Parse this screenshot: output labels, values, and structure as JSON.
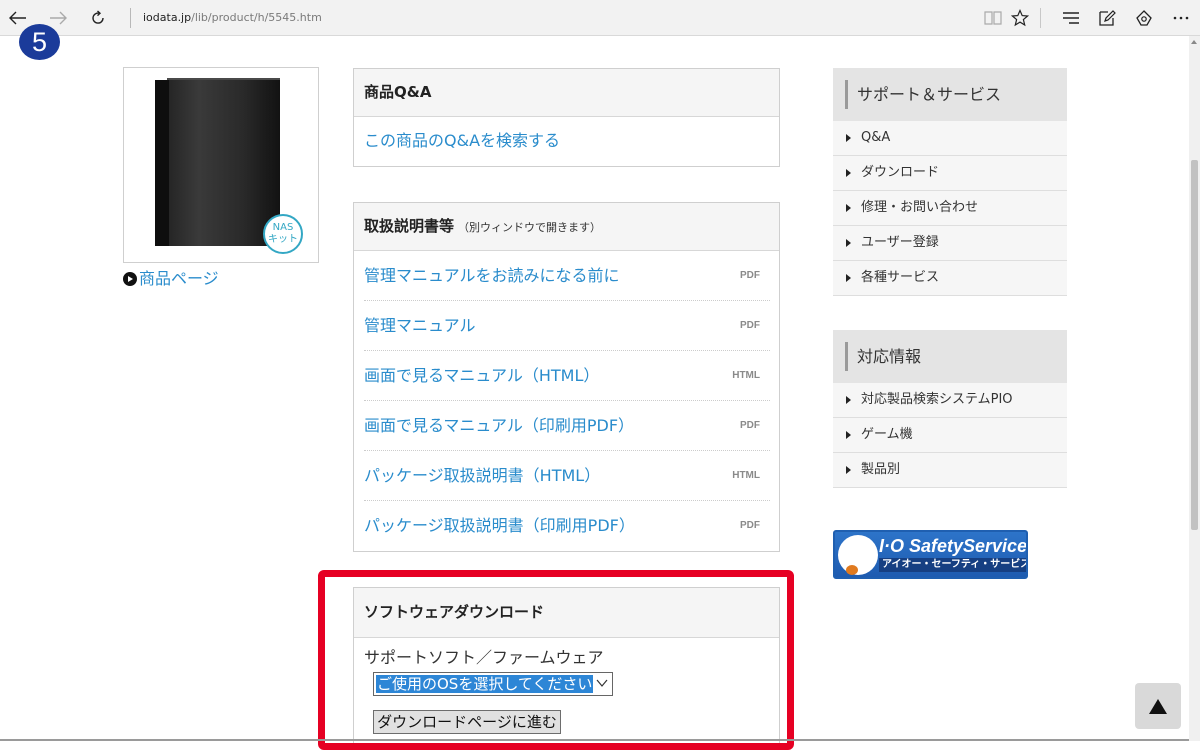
{
  "browser": {
    "address_host": "iodata.jp",
    "address_path": "/lib/product/h/5545.htm"
  },
  "step_badge": "5",
  "product": {
    "nas_badge_line1": "NAS",
    "nas_badge_line2": "キット",
    "link_label": "商品ページ"
  },
  "qa_panel": {
    "title": "商品Q&A",
    "link_label": "この商品のQ&Aを検索する"
  },
  "manual_panel": {
    "title": "取扱説明書等",
    "subtitle": "（別ウィンドウで開きます）",
    "items": [
      {
        "label": "管理マニュアルをお読みになる前に",
        "type": "PDF"
      },
      {
        "label": "管理マニュアル",
        "type": "PDF"
      },
      {
        "label": "画面で見るマニュアル（HTML）",
        "type": "HTML"
      },
      {
        "label": "画面で見るマニュアル（印刷用PDF）",
        "type": "PDF"
      },
      {
        "label": "パッケージ取扱説明書（HTML）",
        "type": "HTML"
      },
      {
        "label": "パッケージ取扱説明書（印刷用PDF）",
        "type": "PDF"
      }
    ]
  },
  "software_panel": {
    "title": "ソフトウェアダウンロード",
    "label": "サポートソフト／ファームウェア",
    "os_select_value": "ご使用のOSを選択してください",
    "download_button": "ダウンロードページに進む"
  },
  "support_menu": {
    "title": "サポート＆サービス",
    "items": [
      "Q&A",
      "ダウンロード",
      "修理・お問い合わせ",
      "ユーザー登録",
      "各種サービス"
    ]
  },
  "compat_menu": {
    "title": "対応情報",
    "items": [
      "対応製品検索システムPIO",
      "ゲーム機",
      "製品別"
    ]
  },
  "safety_banner": {
    "title": "I·O SafetyService",
    "subtitle": "アイオー・セーフティ・サービス"
  },
  "colors": {
    "link": "#2a8ccc",
    "highlight_frame": "#e60023",
    "step_badge": "#1b3b9a"
  }
}
